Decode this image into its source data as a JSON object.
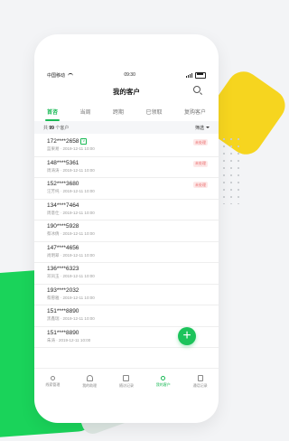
{
  "status_bar": {
    "carrier": "中国移动",
    "time": "09:30"
  },
  "nav": {
    "title": "我的客户"
  },
  "tabs": [
    {
      "label": "首咨",
      "active": true
    },
    {
      "label": "当周"
    },
    {
      "label": "跨期"
    },
    {
      "label": "已领取"
    },
    {
      "label": "复购客户"
    }
  ],
  "filter": {
    "count_prefix": "共",
    "count": "99",
    "count_suffix": "个客户",
    "label": "筛选"
  },
  "customers": [
    {
      "phone": "172****2658",
      "verified": "V",
      "name": "蓝果易",
      "date": "2019-12-11 10:00",
      "status": "未处理"
    },
    {
      "phone": "148****5361",
      "name": "周涛涛",
      "date": "2019-12-11 10:00",
      "status": "未处理"
    },
    {
      "phone": "152****3680",
      "name": "汪芳纯",
      "date": "2019-12-11 10:00",
      "status": "未处理"
    },
    {
      "phone": "134****7464",
      "name": "周意仕",
      "date": "2019-12-11 10:00"
    },
    {
      "phone": "190****5928",
      "name": "蔡冰倩",
      "date": "2019-12-11 10:00"
    },
    {
      "phone": "147****4656",
      "name": "尚明翠",
      "date": "2019-12-11 10:00"
    },
    {
      "phone": "136****6323",
      "name": "邓凤玉",
      "date": "2019-12-11 10:00"
    },
    {
      "phone": "193****2032",
      "name": "蔡愿雅",
      "date": "2019-12-11 10:00"
    },
    {
      "phone": "151****8890",
      "name": "黑鑫瑞",
      "date": "2019-12-11 10:00"
    },
    {
      "phone": "151****8890",
      "name": "朱涛",
      "date": "2019-12-11 10:00"
    }
  ],
  "fab": {
    "label": "+"
  },
  "tabbar": [
    {
      "label": "线索管理",
      "icon": "person-icon"
    },
    {
      "label": "我的助理",
      "icon": "people-icon"
    },
    {
      "label": "随访记录",
      "icon": "calendar-icon"
    },
    {
      "label": "我的客户",
      "icon": "customer-icon",
      "active": true
    },
    {
      "label": "通话记录",
      "icon": "phone-icon"
    }
  ],
  "colors": {
    "accent": "#19b955",
    "background_green": "#1ad35a",
    "background_yellow": "#f6d51f",
    "status_red": "#ea6a6a"
  }
}
